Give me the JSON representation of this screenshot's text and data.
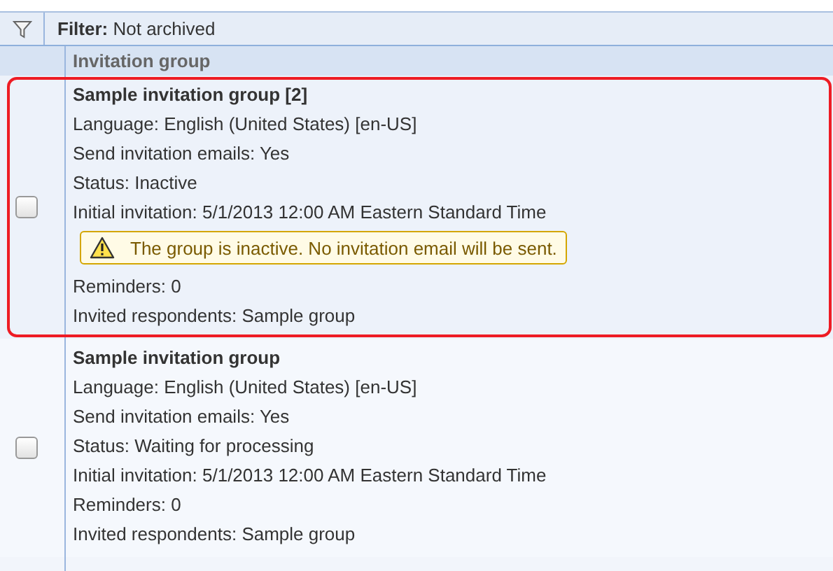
{
  "filter": {
    "label": "Filter:",
    "value": "Not archived"
  },
  "table": {
    "columns": [
      "Invitation group"
    ],
    "rows": [
      {
        "checked": false,
        "highlighted": true,
        "title": "Sample invitation group [2]",
        "lines": [
          {
            "kind": "text",
            "text": "Language: English (United States) [en-US]"
          },
          {
            "kind": "text",
            "text": "Send invitation emails: Yes"
          },
          {
            "kind": "text",
            "text": "Status: Inactive"
          },
          {
            "kind": "text",
            "text": "Initial invitation: 5/1/2013 12:00 AM Eastern Standard Time"
          },
          {
            "kind": "warning",
            "text": "The group is inactive. No invitation email will be sent."
          },
          {
            "kind": "text",
            "text": "Reminders: 0"
          },
          {
            "kind": "text",
            "text": "Invited respondents: Sample group"
          }
        ]
      },
      {
        "checked": false,
        "highlighted": false,
        "title": "Sample invitation group",
        "lines": [
          {
            "kind": "text",
            "text": "Language: English (United States) [en-US]"
          },
          {
            "kind": "text",
            "text": "Send invitation emails: Yes"
          },
          {
            "kind": "text",
            "text": "Status: Waiting for processing"
          },
          {
            "kind": "text",
            "text": "Initial invitation: 5/1/2013 12:00 AM Eastern Standard Time"
          },
          {
            "kind": "text",
            "text": "Reminders: 0"
          },
          {
            "kind": "text",
            "text": "Invited respondents: Sample group"
          }
        ]
      }
    ]
  }
}
